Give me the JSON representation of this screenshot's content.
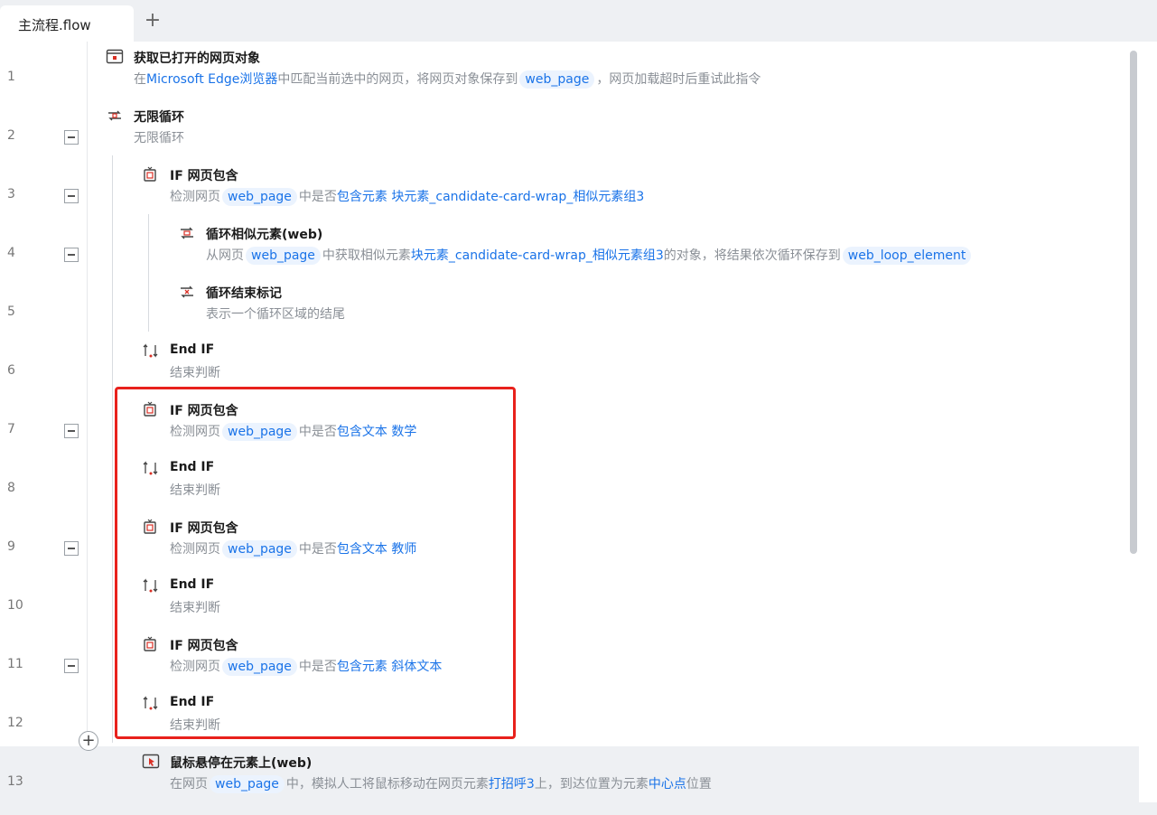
{
  "tabs": {
    "active_label": "主流程.flow",
    "add_label": "+"
  },
  "steps": [
    {
      "line": "1",
      "icon": "browser-page-icon",
      "title": "获取已打开的网页对象",
      "desc": [
        {
          "t": "text",
          "v": "在"
        },
        {
          "t": "link",
          "v": "Microsoft Edge浏览器"
        },
        {
          "t": "text",
          "v": "中匹配当前选中的网页，将网页对象保存到"
        },
        {
          "t": "chip",
          "v": "web_page"
        },
        {
          "t": "text",
          "v": "，网页加载超时后重试此指令"
        }
      ]
    },
    {
      "line": "2",
      "icon": "infinite-loop-icon",
      "title": "无限循环",
      "desc": [
        {
          "t": "text",
          "v": "无限循环"
        }
      ]
    },
    {
      "line": "3",
      "icon": "if-page-contains-icon",
      "title": "IF 网页包含",
      "desc": [
        {
          "t": "text",
          "v": "检测网页"
        },
        {
          "t": "chip",
          "v": "web_page"
        },
        {
          "t": "text",
          "v": "中是否"
        },
        {
          "t": "link",
          "v": "包含元素 块元素_candidate-card-wrap_相似元素组3"
        }
      ]
    },
    {
      "line": "4",
      "icon": "loop-similar-elements-icon",
      "title": "循环相似元素(web)",
      "desc": [
        {
          "t": "text",
          "v": "从网页"
        },
        {
          "t": "chip",
          "v": "web_page"
        },
        {
          "t": "text",
          "v": "中获取相似元素"
        },
        {
          "t": "link",
          "v": "块元素_candidate-card-wrap_相似元素组3"
        },
        {
          "t": "text",
          "v": "的对象，将结果依次循环保存到"
        },
        {
          "t": "chip",
          "v": "web_loop_element"
        }
      ]
    },
    {
      "line": "5",
      "icon": "loop-end-icon",
      "title": "循环结束标记",
      "desc": [
        {
          "t": "text",
          "v": "表示一个循环区域的结尾"
        }
      ]
    },
    {
      "line": "6",
      "icon": "end-if-icon",
      "title": "End IF",
      "desc": [
        {
          "t": "text",
          "v": "结束判断"
        }
      ]
    },
    {
      "line": "7",
      "icon": "if-page-contains-icon",
      "title": "IF 网页包含",
      "desc": [
        {
          "t": "text",
          "v": "检测网页"
        },
        {
          "t": "chip",
          "v": "web_page"
        },
        {
          "t": "text",
          "v": "中是否"
        },
        {
          "t": "link",
          "v": "包含文本 数学"
        }
      ]
    },
    {
      "line": "8",
      "icon": "end-if-icon",
      "title": "End IF",
      "desc": [
        {
          "t": "text",
          "v": "结束判断"
        }
      ]
    },
    {
      "line": "9",
      "icon": "if-page-contains-icon",
      "title": "IF 网页包含",
      "desc": [
        {
          "t": "text",
          "v": "检测网页"
        },
        {
          "t": "chip",
          "v": "web_page"
        },
        {
          "t": "text",
          "v": "中是否"
        },
        {
          "t": "link",
          "v": "包含文本 教师"
        }
      ]
    },
    {
      "line": "10",
      "icon": "end-if-icon",
      "title": "End IF",
      "desc": [
        {
          "t": "text",
          "v": "结束判断"
        }
      ]
    },
    {
      "line": "11",
      "icon": "if-page-contains-icon",
      "title": "IF 网页包含",
      "desc": [
        {
          "t": "text",
          "v": "检测网页"
        },
        {
          "t": "chip",
          "v": "web_page"
        },
        {
          "t": "text",
          "v": "中是否"
        },
        {
          "t": "link",
          "v": "包含元素 斜体文本"
        }
      ]
    },
    {
      "line": "12",
      "icon": "end-if-icon",
      "title": "End IF",
      "desc": [
        {
          "t": "text",
          "v": "结束判断"
        }
      ]
    },
    {
      "line": "13",
      "icon": "mouse-hover-icon",
      "title": "鼠标悬停在元素上(web)",
      "desc": [
        {
          "t": "text",
          "v": "在网页"
        },
        {
          "t": "chip",
          "v": "web_page"
        },
        {
          "t": "text",
          "v": "中，模拟人工将鼠标移动在网页元素"
        },
        {
          "t": "link",
          "v": "打招呼3"
        },
        {
          "t": "text",
          "v": "上，到达位置为元素"
        },
        {
          "t": "link",
          "v": "中心点"
        },
        {
          "t": "text",
          "v": "位置"
        }
      ]
    }
  ],
  "add_step_label": "+",
  "colors": {
    "accent": "#1a73e8",
    "highlight_border": "#e8211c",
    "icon_red": "#d93025"
  }
}
